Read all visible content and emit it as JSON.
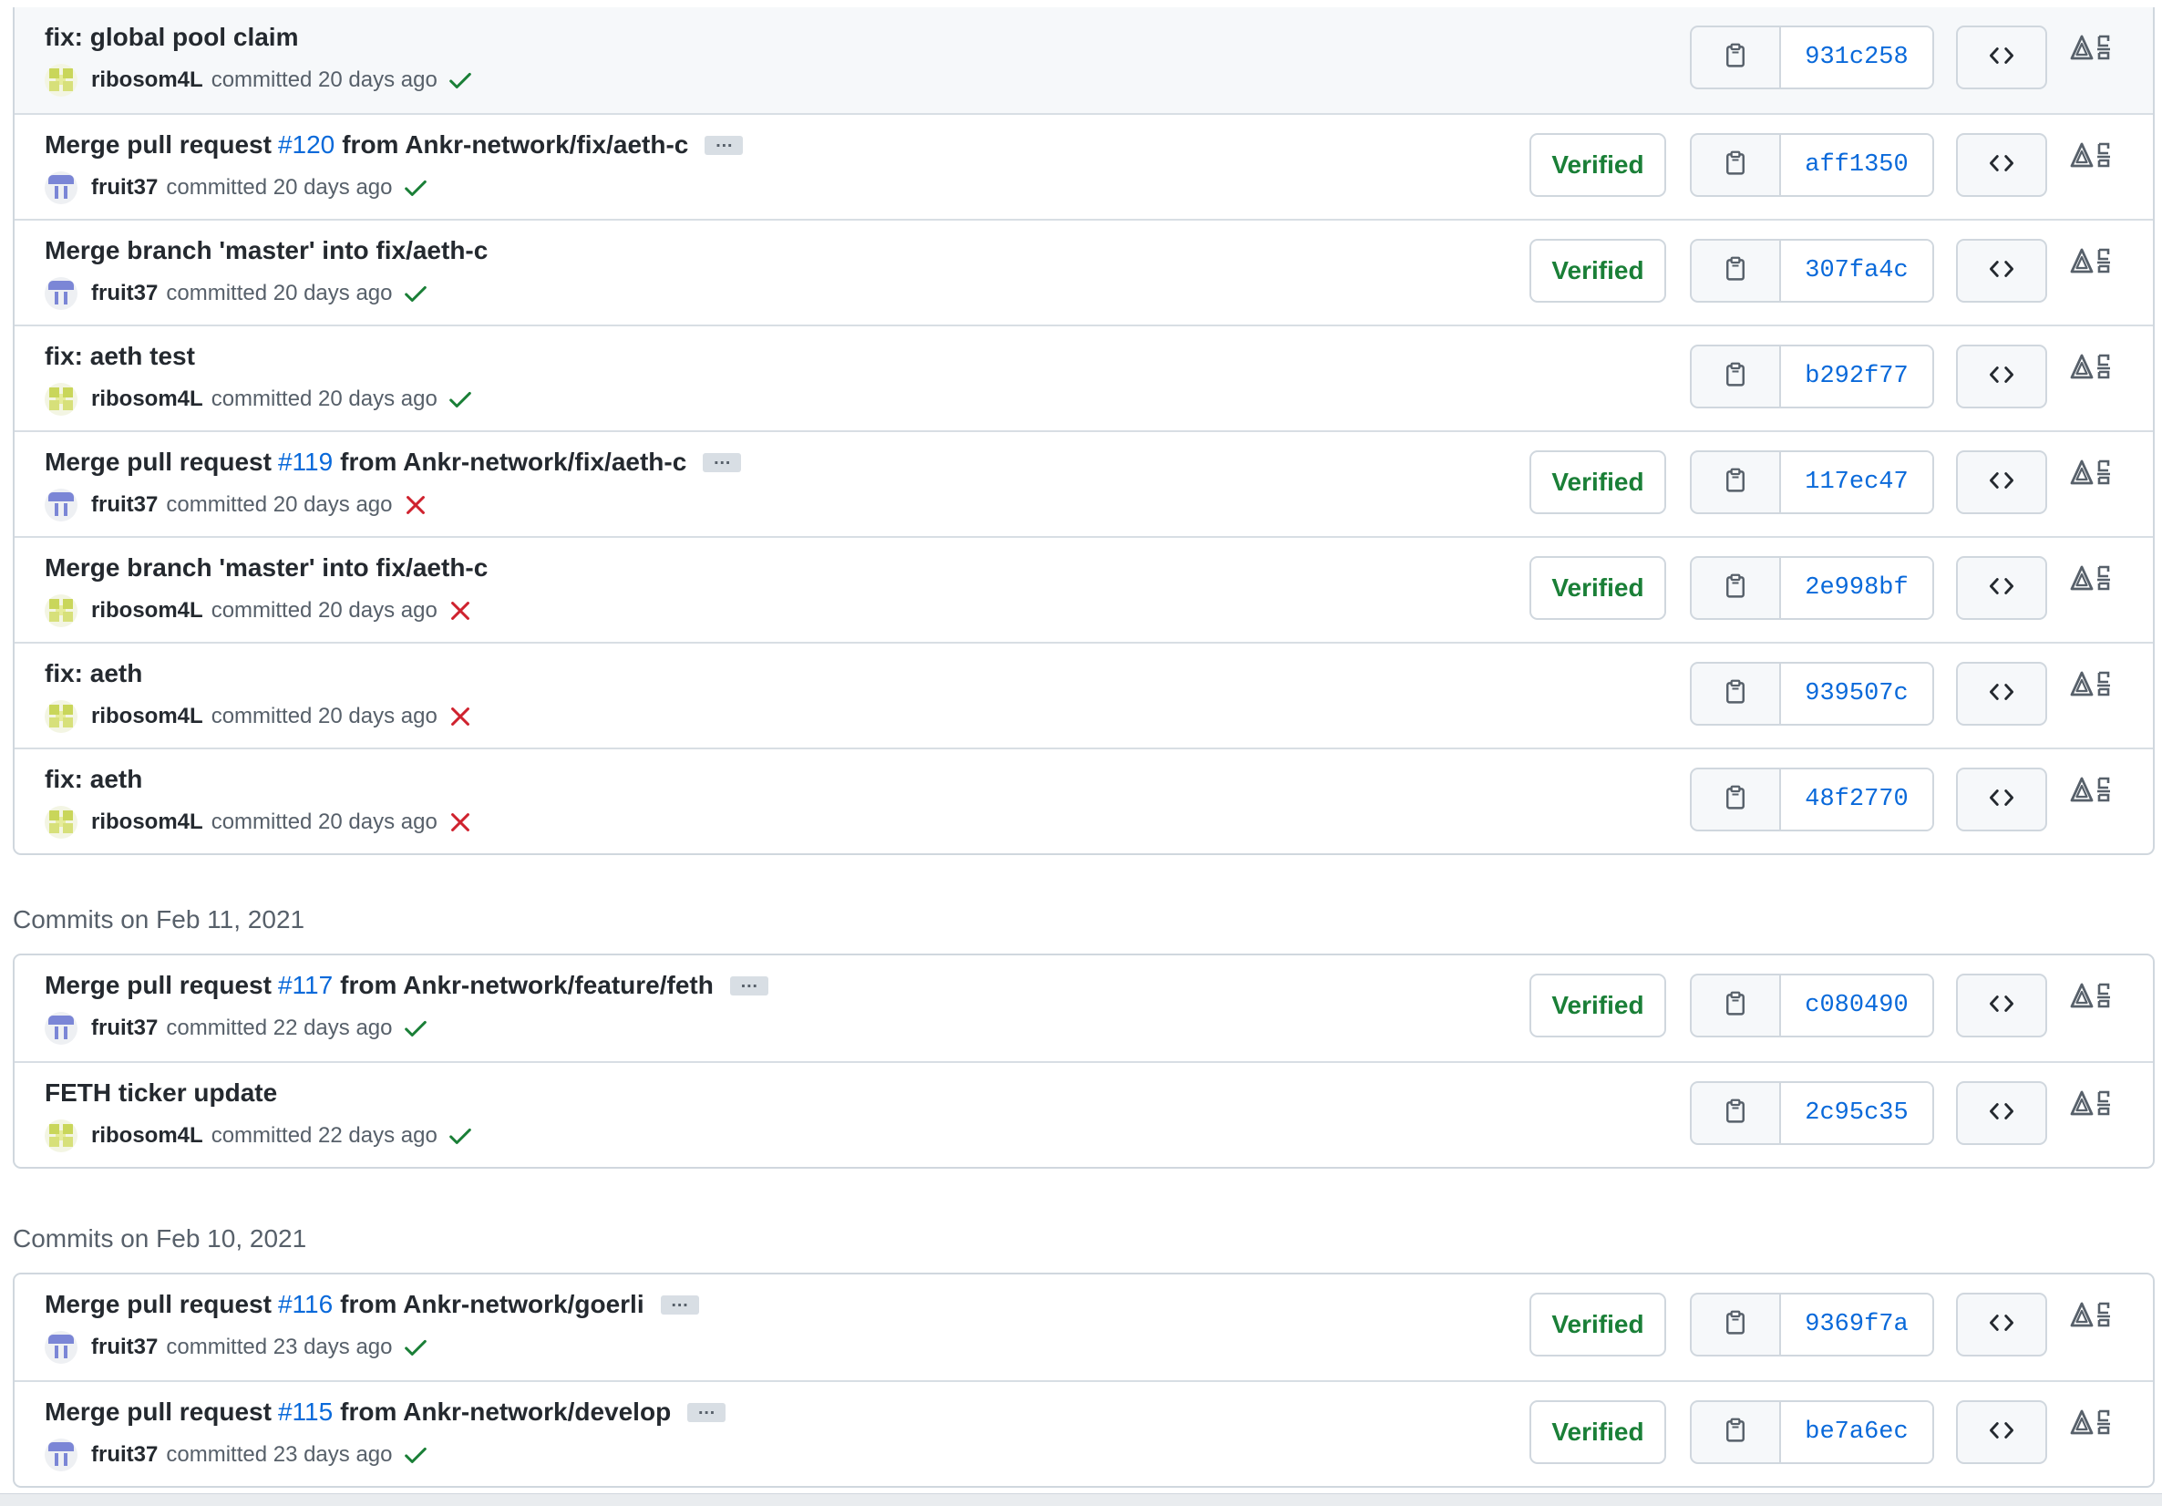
{
  "colors": {
    "verified_text": "#1a7f37",
    "link": "#0969da",
    "success": "#1a7f37",
    "failure": "#cf222e",
    "border": "#d0d7de",
    "muted": "#57606a"
  },
  "groups": [
    {
      "header": "",
      "commits": [
        {
          "title_pre": "fix: global pool claim",
          "pr": "",
          "title_post": "",
          "has_ellipsis": false,
          "avatar": "fruit-avatar-yellow",
          "author": "ribosom4L",
          "time": "committed 20 days ago",
          "status": "success",
          "verified": "",
          "sha": "931c258",
          "highlight": true
        },
        {
          "title_pre": "Merge pull request",
          "pr": "#120",
          "title_post": "from Ankr-network/fix/aeth-c",
          "has_ellipsis": true,
          "avatar": "fruit-avatar-purple",
          "author": "fruit37",
          "time": "committed 20 days ago",
          "status": "success",
          "verified": "Verified",
          "sha": "aff1350",
          "highlight": false
        },
        {
          "title_pre": "Merge branch 'master' into fix/aeth-c",
          "pr": "",
          "title_post": "",
          "has_ellipsis": false,
          "avatar": "fruit-avatar-purple",
          "author": "fruit37",
          "time": "committed 20 days ago",
          "status": "success",
          "verified": "Verified",
          "sha": "307fa4c",
          "highlight": false
        },
        {
          "title_pre": "fix: aeth test",
          "pr": "",
          "title_post": "",
          "has_ellipsis": false,
          "avatar": "fruit-avatar-yellow",
          "author": "ribosom4L",
          "time": "committed 20 days ago",
          "status": "success",
          "verified": "",
          "sha": "b292f77",
          "highlight": false
        },
        {
          "title_pre": "Merge pull request",
          "pr": "#119",
          "title_post": "from Ankr-network/fix/aeth-c",
          "has_ellipsis": true,
          "avatar": "fruit-avatar-purple",
          "author": "fruit37",
          "time": "committed 20 days ago",
          "status": "failure",
          "verified": "Verified",
          "sha": "117ec47",
          "highlight": false
        },
        {
          "title_pre": "Merge branch 'master' into fix/aeth-c",
          "pr": "",
          "title_post": "",
          "has_ellipsis": false,
          "avatar": "fruit-avatar-yellow",
          "author": "ribosom4L",
          "time": "committed 20 days ago",
          "status": "failure",
          "verified": "Verified",
          "sha": "2e998bf",
          "highlight": false
        },
        {
          "title_pre": "fix: aeth",
          "pr": "",
          "title_post": "",
          "has_ellipsis": false,
          "avatar": "fruit-avatar-yellow",
          "author": "ribosom4L",
          "time": "committed 20 days ago",
          "status": "failure",
          "verified": "",
          "sha": "939507c",
          "highlight": false
        },
        {
          "title_pre": "fix: aeth",
          "pr": "",
          "title_post": "",
          "has_ellipsis": false,
          "avatar": "fruit-avatar-yellow",
          "author": "ribosom4L",
          "time": "committed 20 days ago",
          "status": "failure",
          "verified": "",
          "sha": "48f2770",
          "highlight": false
        }
      ]
    },
    {
      "header": "Commits on Feb 11, 2021",
      "commits": [
        {
          "title_pre": "Merge pull request",
          "pr": "#117",
          "title_post": "from Ankr-network/feature/feth",
          "has_ellipsis": true,
          "avatar": "fruit-avatar-purple",
          "author": "fruit37",
          "time": "committed 22 days ago",
          "status": "success",
          "verified": "Verified",
          "sha": "c080490",
          "highlight": false
        },
        {
          "title_pre": "FETH ticker update",
          "pr": "",
          "title_post": "",
          "has_ellipsis": false,
          "avatar": "fruit-avatar-yellow",
          "author": "ribosom4L",
          "time": "committed 22 days ago",
          "status": "success",
          "verified": "",
          "sha": "2c95c35",
          "highlight": false
        }
      ]
    },
    {
      "header": "Commits on Feb 10, 2021",
      "commits": [
        {
          "title_pre": "Merge pull request",
          "pr": "#116",
          "title_post": "from Ankr-network/goerli",
          "has_ellipsis": true,
          "avatar": "fruit-avatar-purple",
          "author": "fruit37",
          "time": "committed 23 days ago",
          "status": "success",
          "verified": "Verified",
          "sha": "9369f7a",
          "highlight": false
        },
        {
          "title_pre": "Merge pull request",
          "pr": "#115",
          "title_post": "from Ankr-network/develop",
          "has_ellipsis": true,
          "avatar": "fruit-avatar-purple",
          "author": "fruit37",
          "time": "committed 23 days ago",
          "status": "success",
          "verified": "Verified",
          "sha": "be7a6ec",
          "highlight": false
        }
      ]
    }
  ],
  "icons": {
    "copy": "clipboard-icon",
    "browse": "code-icon",
    "extension": "extension-icon",
    "ellipsis": "…"
  }
}
